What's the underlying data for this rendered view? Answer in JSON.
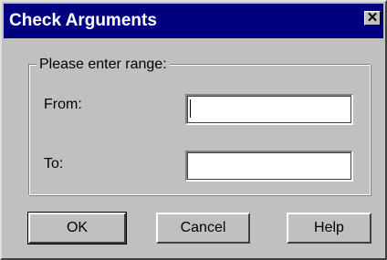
{
  "window": {
    "title": "Check Arguments",
    "close_glyph": "✕"
  },
  "group": {
    "label": "Please enter range:"
  },
  "fields": {
    "from_label": "From:",
    "from_value": "",
    "to_label": "To:",
    "to_value": ""
  },
  "buttons": {
    "ok": "OK",
    "cancel": "Cancel",
    "help": "Help"
  },
  "colors": {
    "titlebar": "#000080",
    "face": "#c0c0c0"
  }
}
